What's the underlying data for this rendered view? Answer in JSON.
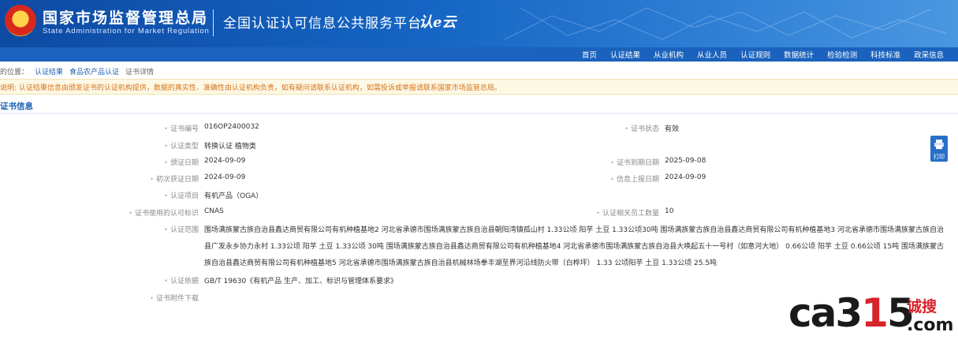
{
  "header": {
    "org_name_cn": "国家市场监督管理总局",
    "org_name_en": "State Administration for Market Regulation",
    "platform_title": "全国认证认可信息公共服务平台",
    "logo_text": "认e云"
  },
  "nav": {
    "items": [
      "首页",
      "认证结果",
      "从业机构",
      "从业人员",
      "认证规则",
      "数据统计",
      "检验检测",
      "科技标准",
      "政采信息"
    ]
  },
  "breadcrumb": {
    "prefix": "的位置：",
    "items": [
      "认证结果",
      "食品农产品认证",
      "证书详情"
    ]
  },
  "notice": {
    "text": "说明: 认证结果信息由颁发证书的认证机构提供，数据的真实性、准确性由认证机构负责，如有疑问请联系认证机构，如需投诉或举报请联系国家市场监管总局。"
  },
  "section": {
    "title": "证书信息"
  },
  "fields": {
    "cert_no_label": "证书编号",
    "cert_no": "016OP2400032",
    "cert_status_label": "证书状态",
    "cert_status": "有效",
    "cert_type_label": "认证类型",
    "cert_type": "转换认证  植物类",
    "issue_date_label": "颁证日期",
    "issue_date": "2024-09-09",
    "expiry_date_label": "证书到期日期",
    "expiry_date": "2025-09-08",
    "first_issue_label": "初次获证日期",
    "first_issue": "2024-09-09",
    "report_date_label": "信息上报日期",
    "report_date": "2024-09-09",
    "project_label": "认证项目",
    "project": "有机产品（OGA）",
    "accred_mark_label": "证书使用的认可标识",
    "accred_mark": "CNAS",
    "related_count_label": "认证相关员工数量",
    "related_count": "10",
    "scope_label": "认证范围",
    "scope": "围场满族蒙古族自治县鑫达商贸有限公司有机种植基地2 河北省承德市围场满族蒙古族自治县朝阳湾镇孤山村 1.33公顷 阳芋 土豆 1.33公顷30吨 围场满族蒙古族自治县鑫达商贸有限公司有机种植基地3 河北省承德市围场满族蒙古族自治县广发永乡协力永村 1.33公顷 阳芋 土豆 1.33公顷 30吨 围场满族蒙古族自治县鑫达商贸有限公司有机种植基地4 河北省承德市围场满族蒙古族自治县大唤起五十一号村（如意河大地） 0.66公顷 阳芋 土豆 0.66公顷 15吨 围场满族蒙古族自治县鑫达商贸有限公司有机种植基地5 河北省承德市围场满族蒙古族自治县机械林场拳丰湖至界河沿线防火带（白桦坪） 1.33 公顷阳芋 土豆 1.33公顷 25.5吨",
    "basis_label": "认证依据",
    "basis": "GB/T 19630《有机产品 生产、加工、标识与管理体系要求》",
    "download_label": "证书附件下载"
  },
  "print_button": {
    "label": "打印"
  },
  "watermark": {
    "main_black_1": "ca3",
    "main_red": "1",
    "main_black_2": "5",
    "cn": "诚搜",
    "com": ".com"
  }
}
